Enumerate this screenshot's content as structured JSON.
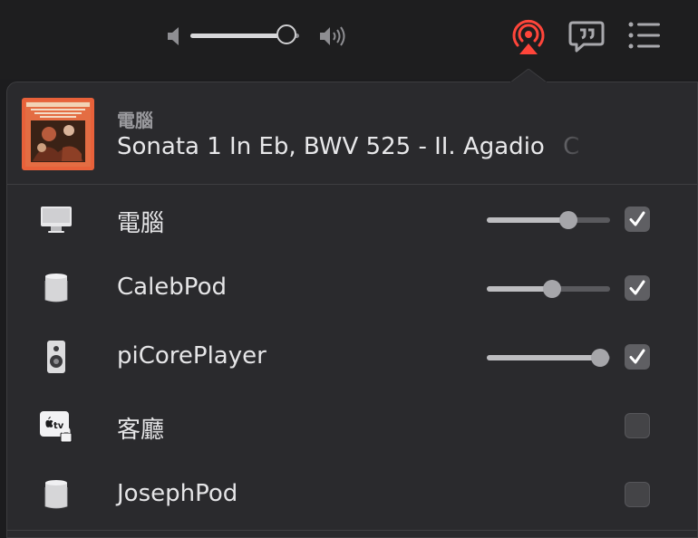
{
  "toolbar": {
    "volume": 0.88,
    "icons": [
      "speaker-min-icon",
      "speaker-max-icon",
      "airplay-icon",
      "lyrics-icon",
      "queue-icon"
    ],
    "airplay_active_color": "#ff453a"
  },
  "now_playing": {
    "device": "電腦",
    "track": "Sonata 1 In Eb, BWV 525 - II. Agadio",
    "track_overflow": "C",
    "album_art": "album-art"
  },
  "devices": [
    {
      "name": "電腦",
      "icon": "computer-icon",
      "checked": true,
      "volume": 0.66
    },
    {
      "name": "CalebPod",
      "icon": "homepod-icon",
      "checked": true,
      "volume": 0.53
    },
    {
      "name": "piCorePlayer",
      "icon": "speaker-icon",
      "checked": true,
      "volume": 0.92
    },
    {
      "name": "客廳",
      "icon": "apple-tv-locked-icon",
      "checked": false,
      "volume": null
    },
    {
      "name": "JosephPod",
      "icon": "homepod-icon",
      "checked": false,
      "volume": null
    }
  ],
  "colors": {
    "popover_bg": "#2a2a2d",
    "checkbox_on": "#5f5f63",
    "checkbox_off": "#444447"
  }
}
